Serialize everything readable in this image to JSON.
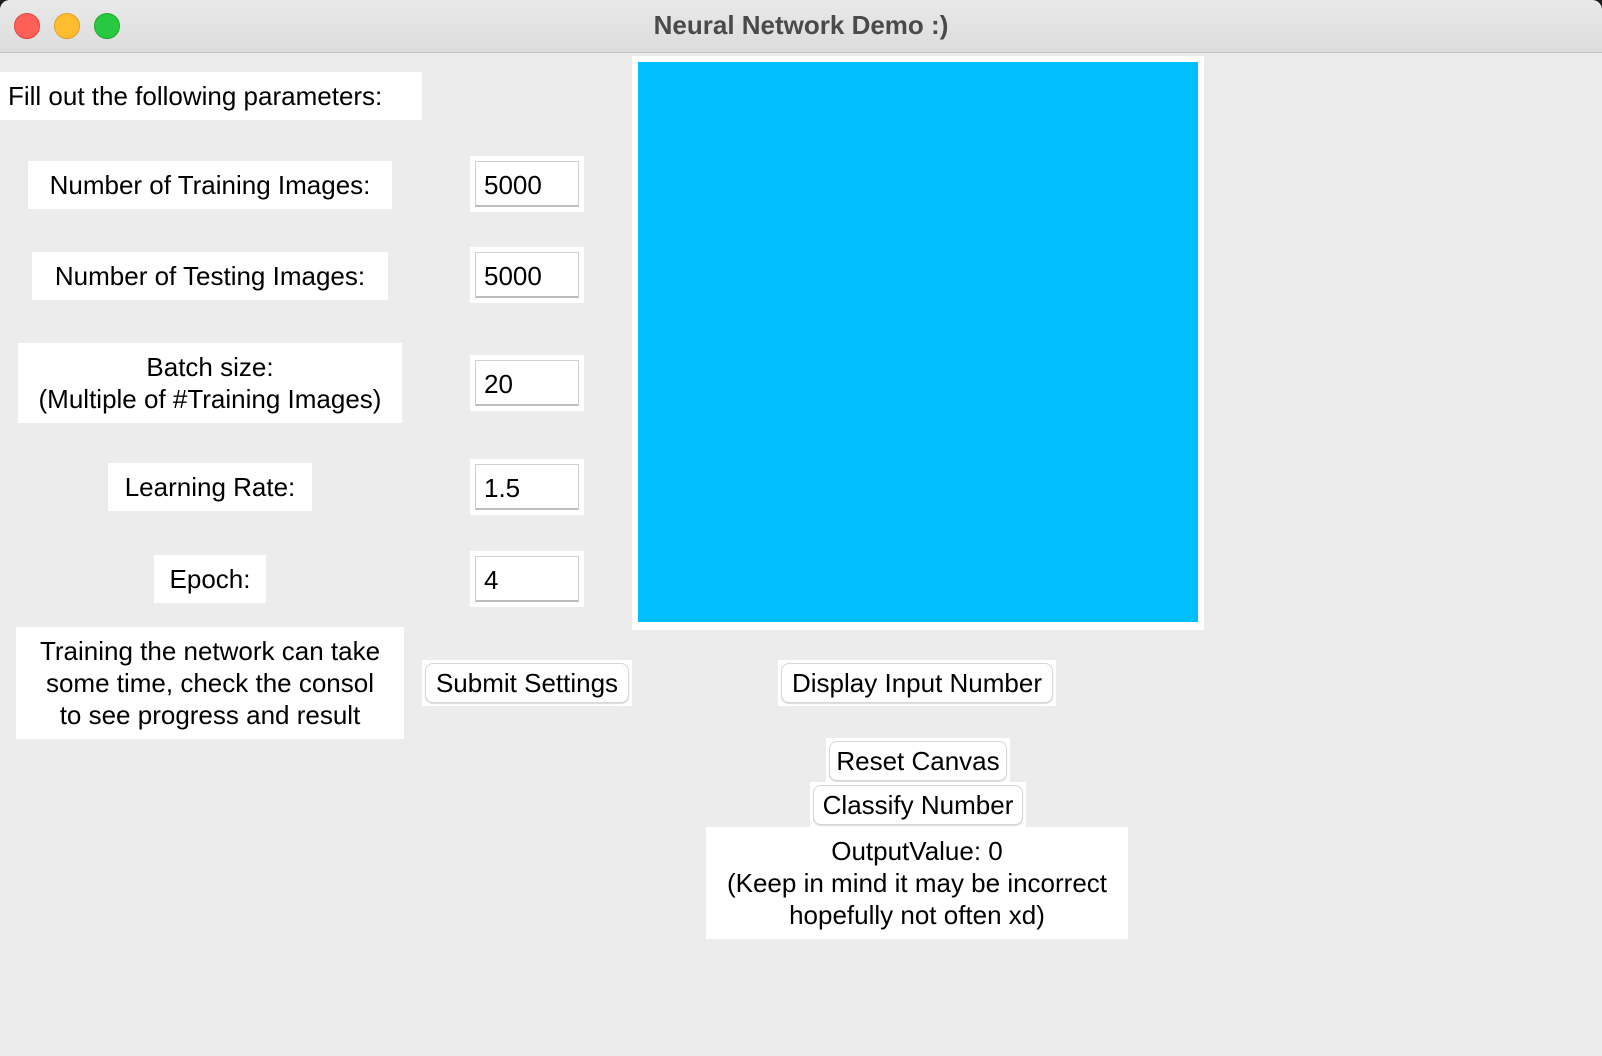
{
  "window": {
    "title": "Neural Network Demo :)"
  },
  "params": {
    "heading": "Fill out the following parameters:",
    "training_images": {
      "label": "Number of Training Images:",
      "value": "5000"
    },
    "testing_images": {
      "label": "Number of Testing Images:",
      "value": "5000"
    },
    "batch_size": {
      "label_line1": "Batch size:",
      "label_line2": "(Multiple of #Training Images)",
      "value": "20"
    },
    "learning_rate": {
      "label": "Learning Rate:",
      "value": "1.5"
    },
    "epoch": {
      "label": "Epoch:",
      "value": "4"
    },
    "note_line1": "Training the network can take",
    "note_line2": "some time, check the consol",
    "note_line3": "to see progress and result",
    "submit_label": "Submit Settings"
  },
  "canvas": {
    "fill_color": "#00bfff",
    "display_label": "Display Input Number",
    "reset_label": "Reset Canvas",
    "classify_label": "Classify Number"
  },
  "output": {
    "line1": "OutputValue: 0",
    "line2": "(Keep in mind it may be incorrect",
    "line3": "hopefully not often xd)"
  }
}
